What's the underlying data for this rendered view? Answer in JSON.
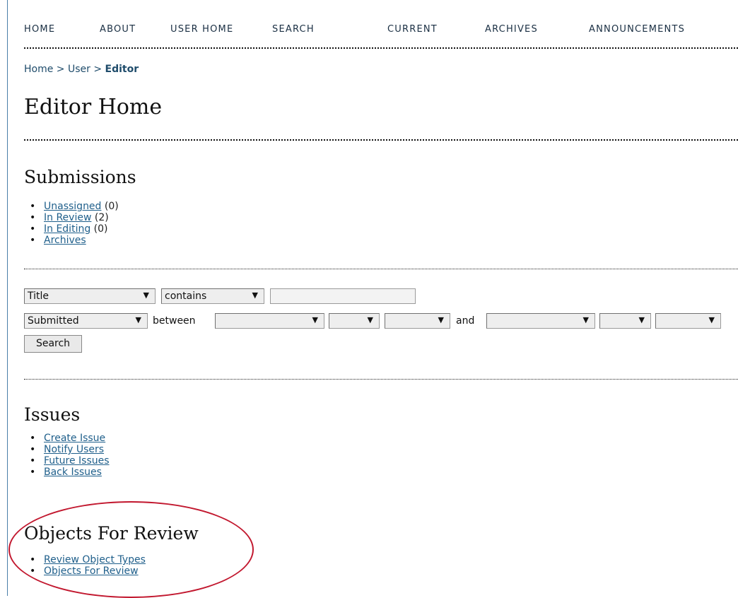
{
  "nav": {
    "items": [
      {
        "label": "HOME"
      },
      {
        "label": "ABOUT"
      },
      {
        "label": "USER HOME"
      },
      {
        "label": "SEARCH"
      },
      {
        "label": "CURRENT"
      },
      {
        "label": "ARCHIVES"
      },
      {
        "label": "ANNOUNCEMENTS"
      }
    ]
  },
  "breadcrumb": {
    "home": "Home",
    "sep1": ">",
    "user": "User",
    "sep2": ">",
    "current": "Editor"
  },
  "page_title": "Editor Home",
  "submissions": {
    "heading": "Submissions",
    "items": [
      {
        "label": "Unassigned",
        "count": "(0)"
      },
      {
        "label": "In Review",
        "count": "(2)"
      },
      {
        "label": "In Editing",
        "count": "(0)"
      },
      {
        "label": "Archives",
        "count": ""
      }
    ]
  },
  "filters": {
    "field_select": "Title",
    "match_select": "contains",
    "search_value": "",
    "date_field_select": "Submitted",
    "between_label": "between",
    "and_label": "and",
    "from_month": "",
    "from_day": "",
    "from_year": "",
    "to_month": "",
    "to_day": "",
    "to_year": "",
    "search_button": "Search"
  },
  "issues": {
    "heading": "Issues",
    "items": [
      {
        "label": "Create Issue"
      },
      {
        "label": "Notify Users"
      },
      {
        "label": "Future Issues"
      },
      {
        "label": "Back Issues"
      }
    ]
  },
  "objects_for_review": {
    "heading": "Objects For Review",
    "items": [
      {
        "label": "Review Object Types"
      },
      {
        "label": "Objects For Review"
      }
    ]
  },
  "colors": {
    "link": "#1f5f8b",
    "highlight": "#c2182f"
  }
}
